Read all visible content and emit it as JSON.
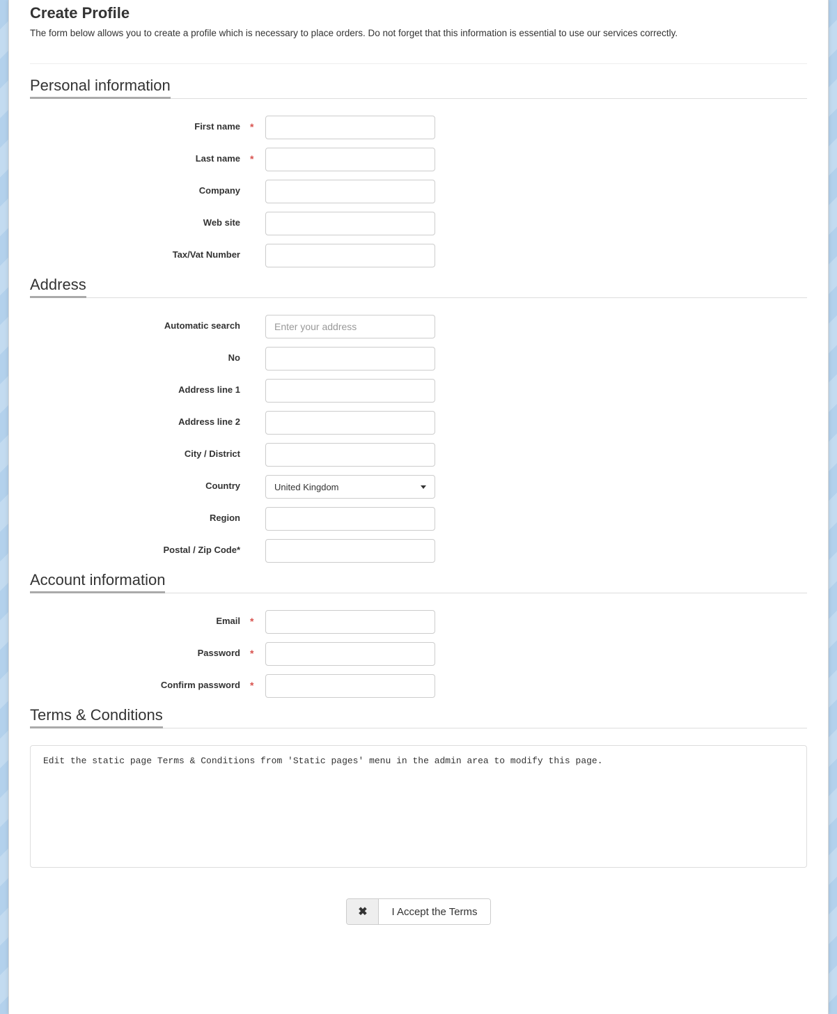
{
  "page": {
    "title": "Create Profile",
    "description": "The form below allows you to create a profile which is necessary to place orders. Do not forget that this information is essential to use our services correctly."
  },
  "sections": {
    "personal": {
      "heading": "Personal information",
      "fields": {
        "first_name": {
          "label": "First name",
          "required": "*",
          "value": ""
        },
        "last_name": {
          "label": "Last name",
          "required": "*",
          "value": ""
        },
        "company": {
          "label": "Company",
          "required": "",
          "value": ""
        },
        "website": {
          "label": "Web site",
          "required": "",
          "value": ""
        },
        "tax": {
          "label": "Tax/Vat Number",
          "required": "",
          "value": ""
        }
      }
    },
    "address": {
      "heading": "Address",
      "fields": {
        "auto_search": {
          "label": "Automatic search",
          "placeholder": "Enter your address",
          "value": ""
        },
        "no": {
          "label": "No",
          "value": ""
        },
        "line1": {
          "label": "Address line 1",
          "value": ""
        },
        "line2": {
          "label": "Address line 2",
          "value": ""
        },
        "city": {
          "label": "City / District",
          "value": ""
        },
        "country": {
          "label": "Country",
          "value": "United Kingdom"
        },
        "region": {
          "label": "Region",
          "value": ""
        },
        "postal": {
          "label": "Postal / Zip Code*",
          "value": ""
        }
      }
    },
    "account": {
      "heading": "Account information",
      "fields": {
        "email": {
          "label": "Email",
          "required": "*",
          "value": ""
        },
        "password": {
          "label": "Password",
          "required": "*",
          "value": ""
        },
        "confirm": {
          "label": "Confirm password",
          "required": "*",
          "value": ""
        }
      }
    },
    "terms": {
      "heading": "Terms & Conditions",
      "body": "Edit the static page Terms & Conditions from 'Static pages' menu in the admin area to modify this page."
    }
  },
  "accept": {
    "icon": "✖",
    "label": "I Accept the Terms"
  }
}
